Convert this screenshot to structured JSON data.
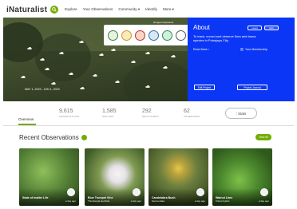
{
  "nav": {
    "brand": "iNaturalist",
    "links": [
      "Explore",
      "Your Observations",
      "Community ▾",
      "Identify",
      "More ▾"
    ]
  },
  "hero": {
    "logos_caption": "Dengan kerjasama",
    "date_range": "MAY 1, 2023 - JUN 1, 2023"
  },
  "about": {
    "title": "About",
    "description": "To track, record and observe flora and fauna species in Putrajaya City.",
    "read_more": "Read More ›",
    "membership": "Your Membership",
    "join": "Leave",
    "follow": "Edit",
    "edit_project": "Edit Project",
    "project_journal": "Project Journal"
  },
  "tabs": {
    "overview": "Overview"
  },
  "stats": [
    {
      "value": "9,615",
      "label": "OBSERVATIONS"
    },
    {
      "value": "1,585",
      "label": "SPECIES"
    },
    {
      "value": "292",
      "label": "IDENTIFIERS"
    },
    {
      "value": "62",
      "label": "OBSERVERS"
    }
  ],
  "stats_button": "Stats",
  "recent": {
    "title": "Recent Observations",
    "view_all": "View All",
    "cards": [
      {
        "title": "State of matter Life",
        "subtitle": "",
        "time": "a day ago",
        "color": "#4f7a33"
      },
      {
        "title": "Blue Trumpet Vine",
        "subtitle": "Thunbergia laurifolia",
        "time": "a day ago",
        "color": "#6d7f40"
      },
      {
        "title": "Candelabra Bush",
        "subtitle": "Senna alata",
        "time": "a day ago",
        "color": "#5c6e3c"
      },
      {
        "title": "Walnut Lime",
        "subtitle": "Citrus hystrix",
        "time": "a day ago",
        "color": "#3f6a2a"
      }
    ]
  },
  "colors": {
    "accent": "#74ac00",
    "about_bg": "#0b36f5"
  }
}
